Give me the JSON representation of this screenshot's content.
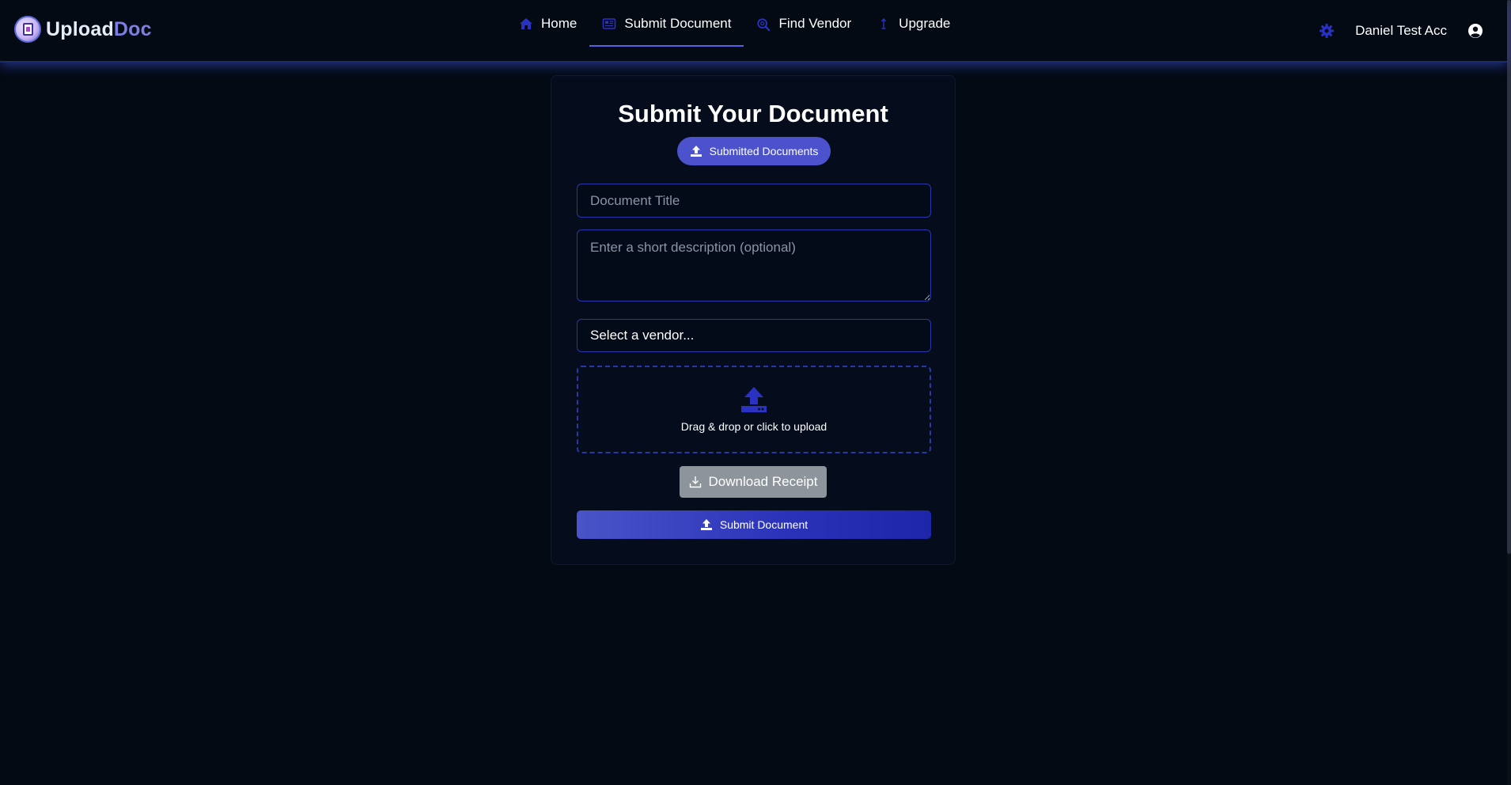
{
  "brand": {
    "name_part1": "Upload",
    "name_part2": "Doc",
    "logo_icon": "document-logo-icon"
  },
  "nav": {
    "items": [
      {
        "label": "Home",
        "icon": "home-icon",
        "active": false
      },
      {
        "label": "Submit Document",
        "icon": "newspaper-icon",
        "active": true
      },
      {
        "label": "Find Vendor",
        "icon": "search-icon",
        "active": false
      },
      {
        "label": "Upgrade",
        "icon": "arrow-up-icon",
        "active": false
      }
    ],
    "settings_icon": "gear-icon",
    "user_name": "Daniel Test Acc",
    "user_icon": "user-circle-icon"
  },
  "form": {
    "title": "Submit Your Document",
    "submitted_docs_label": "Submitted Documents",
    "doc_title_placeholder": "Document Title",
    "doc_title_value": "",
    "description_placeholder": "Enter a short description (optional)",
    "description_value": "",
    "vendor_selected": "Select a vendor...",
    "dropzone_text": "Drag & drop or click to upload",
    "download_receipt_label": "Download Receipt",
    "submit_label": "Submit Document"
  },
  "colors": {
    "background": "#030a14",
    "accent": "#4b52cc",
    "accent_dark": "#1d25a8",
    "icon_blue": "#2a32c4",
    "border": "#2a37a9",
    "disabled_button": "#8e949c"
  }
}
